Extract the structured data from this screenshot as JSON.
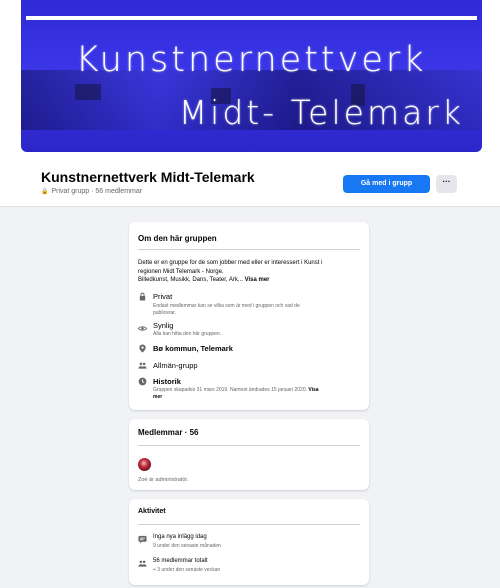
{
  "cover": {
    "line1": "Kunstnernettverk",
    "line2": "Midt- Telemark"
  },
  "group": {
    "name": "Kunstnernettverk Midt-Telemark",
    "meta": "Privat grupp · 56 medlemmar",
    "join_label": "Gå med i grupp",
    "more_label": "···"
  },
  "about": {
    "title": "Om den här gruppen",
    "description_line1": "Dette er en gruppe for de som jobber med eller er interessert i Kunst i",
    "description_line2": "regionen Midt Telemark - Norge.",
    "description_line3": "Billedkunst, Musikk, Dans, Teater, Ark...",
    "see_more": "Visa mer",
    "rows": [
      {
        "icon": "lock-icon",
        "title": "Privat",
        "sub1": "Endast medlemmar kan se vilka som är med i gruppen och vad de",
        "sub2": "publicerar."
      },
      {
        "icon": "eye-icon",
        "title": "Synlig",
        "sub1": "Alla kan hitta den här gruppen."
      },
      {
        "icon": "location-icon",
        "title": "Bø kommun, Telemark"
      },
      {
        "icon": "group-icon",
        "title": "Allmän-grupp"
      },
      {
        "icon": "clock-icon",
        "title": "Historik",
        "sub1": "Gruppen skapades 31 mars 2019. Namnet ändrades 15 januari 2020.",
        "sub1_link": "Visa",
        "sub2": "mer"
      }
    ]
  },
  "members": {
    "title": "Medlemmar · 56",
    "admin_text": "Zoé är administratör."
  },
  "activity": {
    "title": "Aktivitet",
    "rows": [
      {
        "icon": "chat-icon",
        "title": "Inga nya inlägg idag",
        "sub": "9 under den senaste månaden"
      },
      {
        "icon": "people-icon",
        "title": "56 medlemmar totalt",
        "sub": "+ 3 under den senaste veckan"
      }
    ]
  },
  "colors": {
    "accent": "#1877f2",
    "cover_blue": "#3a36e8",
    "background": "#f0f2f5"
  }
}
